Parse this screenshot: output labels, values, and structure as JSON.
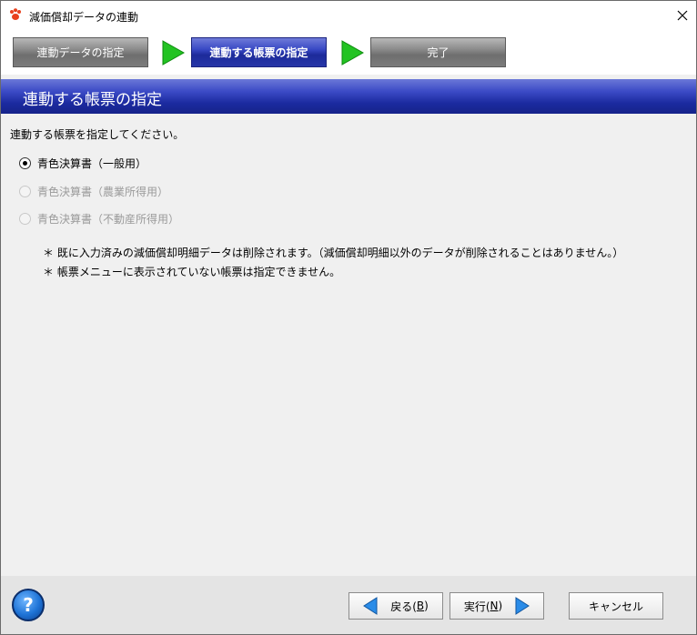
{
  "window": {
    "title": "減価償却データの連動",
    "close_icon": "close-icon",
    "app_icon": "paw-icon"
  },
  "steps": [
    {
      "label": "連動データの指定",
      "state": "done"
    },
    {
      "label": "連動する帳票の指定",
      "state": "active"
    },
    {
      "label": "完了",
      "state": "pending"
    }
  ],
  "header": {
    "title": "連動する帳票の指定"
  },
  "content": {
    "instruction": "連動する帳票を指定してください。",
    "options": [
      {
        "label": "青色決算書（一般用）",
        "checked": true,
        "enabled": true
      },
      {
        "label": "青色決算書（農業所得用）",
        "checked": false,
        "enabled": false
      },
      {
        "label": "青色決算書（不動産所得用）",
        "checked": false,
        "enabled": false
      }
    ],
    "notes": [
      "＊ 既に入力済みの減価償却明細データは削除されます。（減価償却明細以外のデータが削除されることはありません。）",
      "＊ 帳票メニューに表示されていない帳票は指定できません。"
    ]
  },
  "footer": {
    "help_label": "?",
    "back_label": "戻る(",
    "back_key": "B",
    "back_suffix": ")",
    "run_label": "実行(",
    "run_key": "N",
    "run_suffix": ")",
    "cancel_label": "キャンセル"
  },
  "colors": {
    "accent_blue": "#1c2a9a",
    "step_arrow_green": "#22c322"
  }
}
